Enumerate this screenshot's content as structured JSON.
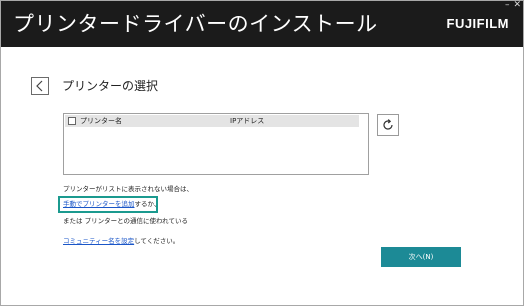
{
  "window": {
    "title": "プリンタードライバーのインストール",
    "logo": "FUJIFILM",
    "minimize_glyph": "–",
    "close_glyph": "✕"
  },
  "page": {
    "heading": "プリンターの選択"
  },
  "printer_list": {
    "columns": [
      "プリンター名",
      "IPアドレス"
    ],
    "rows": []
  },
  "info": {
    "not_listed": "プリンターがリストに表示されない場合は、",
    "manual_add_link": "手動でプリンターを追加",
    "manual_add_suffix": "するか、",
    "or_check": "または プリンターとの通信に使われている",
    "community_link": "コミュニティー名を設定",
    "community_suffix": "してください。"
  },
  "buttons": {
    "next": "次へ(N)"
  },
  "colors": {
    "titlebar": "#1b1b1b",
    "accent_button": "#1c8a96",
    "highlight_box": "#1b9a8f",
    "link": "#1a56c8"
  },
  "icons": {
    "back": "chevron-left-icon",
    "refresh": "refresh-icon"
  }
}
